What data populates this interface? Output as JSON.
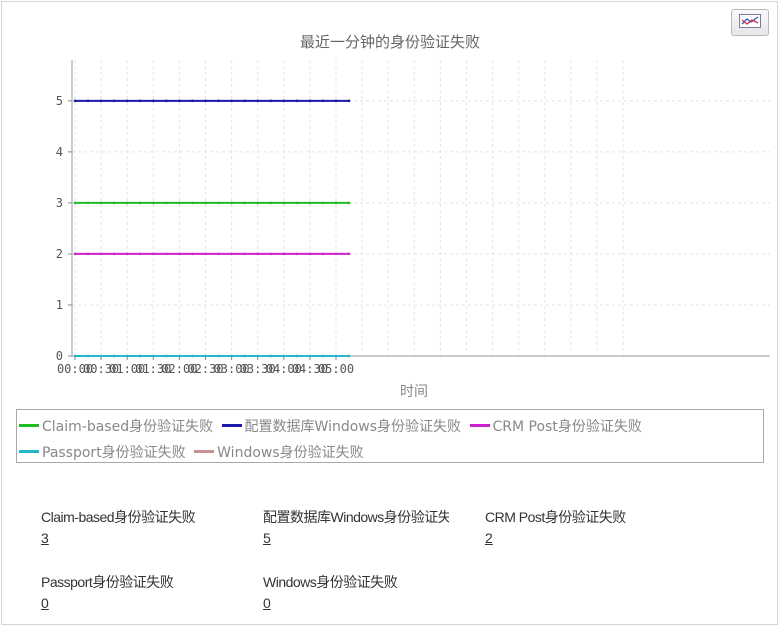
{
  "chart_data": {
    "type": "line",
    "title": "最近一分钟的身份验证失败",
    "xlabel": "时间",
    "ylabel": "",
    "x_ticks": [
      "00:00",
      "00:30",
      "01:00",
      "01:30",
      "02:00",
      "02:30",
      "03:00",
      "03:30",
      "04:00",
      "04:30",
      "05:00"
    ],
    "x": [
      "00:00",
      "00:15",
      "00:30",
      "00:45",
      "01:00",
      "01:15",
      "01:30",
      "01:45",
      "02:00",
      "02:15",
      "02:30",
      "02:45",
      "03:00",
      "03:15",
      "03:30",
      "03:45",
      "04:00",
      "04:15",
      "04:30",
      "04:45",
      "05:00",
      "05:15"
    ],
    "ylim": [
      0,
      5.8
    ],
    "y_ticks": [
      0,
      1,
      2,
      3,
      4,
      5
    ],
    "grid": true,
    "legend_position": "bottom",
    "series": [
      {
        "name": "Claim-based身份验证失败",
        "color": "#22bb22",
        "values": [
          3,
          3,
          3,
          3,
          3,
          3,
          3,
          3,
          3,
          3,
          3,
          3,
          3,
          3,
          3,
          3,
          3,
          3,
          3,
          3,
          3,
          3
        ]
      },
      {
        "name": "配置数据库Windows身份验证失败",
        "color": "#1a1aa8",
        "values": [
          5,
          5,
          5,
          5,
          5,
          5,
          5,
          5,
          5,
          5,
          5,
          5,
          5,
          5,
          5,
          5,
          5,
          5,
          5,
          5,
          5,
          5
        ]
      },
      {
        "name": "CRM Post身份验证失败",
        "color": "#cc22cc",
        "values": [
          2,
          2,
          2,
          2,
          2,
          2,
          2,
          2,
          2,
          2,
          2,
          2,
          2,
          2,
          2,
          2,
          2,
          2,
          2,
          2,
          2,
          2
        ]
      },
      {
        "name": "Passport身份验证失败",
        "color": "#22b8c8",
        "values": [
          0,
          0,
          0,
          0,
          0,
          0,
          0,
          0,
          0,
          0,
          0,
          0,
          0,
          0,
          0,
          0,
          0,
          0,
          0,
          0,
          0,
          0
        ]
      },
      {
        "name": "Windows身份验证失败",
        "color": "#c89090",
        "values": [
          0,
          0,
          0,
          0,
          0,
          0,
          0,
          0,
          0,
          0,
          0,
          0,
          0,
          0,
          0,
          0,
          0,
          0,
          0,
          0,
          0,
          0
        ]
      }
    ]
  },
  "toolbar": {
    "chart_icon": "line-chart-icon"
  },
  "summary": [
    {
      "label": "Claim-based身份验证失败",
      "value": "3"
    },
    {
      "label": "配置数据库Windows身份验证失败",
      "value": "5"
    },
    {
      "label": "CRM Post身份验证失败",
      "value": "2"
    },
    {
      "label": "Passport身份验证失败",
      "value": "0"
    },
    {
      "label": "Windows身份验证失败",
      "value": "0"
    }
  ]
}
